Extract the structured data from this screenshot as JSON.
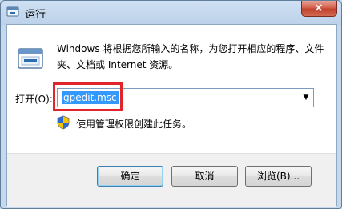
{
  "window": {
    "title": "运行",
    "close_symbol": "×"
  },
  "body": {
    "description": "Windows 将根据您所输入的名称，为您打开相应的程序、文件夹、文档或 Internet 资源。",
    "open_label": "打开(O):",
    "input_value": "gpedit.msc",
    "admin_note": "使用管理权限创建此任务。"
  },
  "buttons": {
    "ok": "确定",
    "cancel": "取消",
    "browse": "浏览(B)..."
  },
  "colors": {
    "selection": "#3399ff",
    "annotation_box": "#e0262b",
    "close_button": "#c2412d"
  },
  "icons": [
    "run-app-icon",
    "run-program-icon",
    "dropdown-arrow-icon",
    "uac-shield-icon",
    "close-icon"
  ]
}
